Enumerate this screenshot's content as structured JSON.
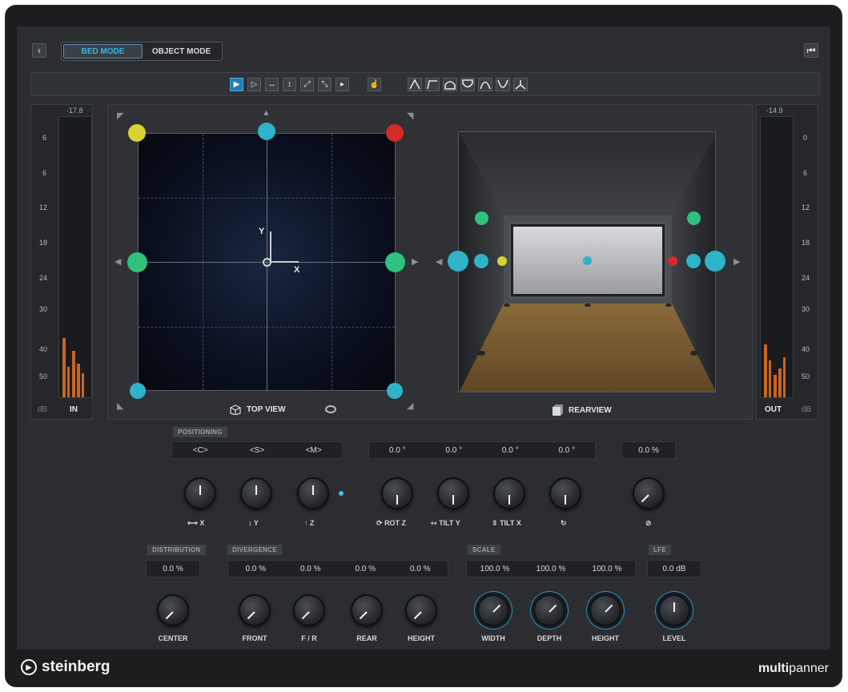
{
  "header": {
    "back_icon": "chevron-left-icon",
    "modes": [
      "BED MODE",
      "OBJECT MODE"
    ],
    "active_mode": "BED MODE",
    "end_icon": "skip-to-start-icon"
  },
  "toolbar": {
    "tools": [
      "select-arrow-icon",
      "select-outline-icon",
      "move-x-icon",
      "move-y-icon",
      "move-diagonal-icon",
      "move-diagonal-alt-icon",
      "cursor-flag-icon",
      "hand-pointer-icon"
    ],
    "shapes": [
      "shape-peak-icon",
      "shape-corner-icon",
      "shape-dome-icon",
      "shape-bowl-icon",
      "shape-arch-icon",
      "shape-valley-icon",
      "shape-fork-icon"
    ]
  },
  "meter_in": {
    "peak": "-17.8",
    "ticks": [
      "6",
      "6",
      "12",
      "18",
      "24",
      "30",
      "40",
      "50"
    ],
    "unit": "dB",
    "label": "IN"
  },
  "meter_out": {
    "peak": "-14.9",
    "ticks": [
      "0",
      "6",
      "12",
      "18",
      "24",
      "30",
      "40",
      "50"
    ],
    "unit": "dB",
    "label": "OUT"
  },
  "views": {
    "top_label": "TOP VIEW",
    "rear_label": "REARVIEW",
    "axis_y": "Y",
    "axis_x": "X"
  },
  "positioning": {
    "tag": "POSITIONING",
    "fields1": [
      "<C>",
      "<S>",
      "<M>"
    ],
    "fields2": [
      "0.0 °",
      "0.0 °",
      "0.0 °",
      "0.0 °"
    ],
    "field3": "0.0 %",
    "knob_labels": [
      "X",
      "Y",
      "Z",
      "ROT Z",
      "TILT Y",
      "TILT X"
    ]
  },
  "distribution": {
    "tag": "DISTRIBUTION",
    "value": "0.0 %",
    "knob": "CENTER"
  },
  "divergence": {
    "tag": "DIVERGENCE",
    "values": [
      "0.0 %",
      "0.0 %",
      "0.0 %",
      "0.0 %"
    ],
    "knobs": [
      "FRONT",
      "F / R",
      "REAR",
      "HEIGHT"
    ]
  },
  "scale": {
    "tag": "SCALE",
    "values": [
      "100.0 %",
      "100.0 %",
      "100.0 %"
    ],
    "knobs": [
      "WIDTH",
      "DEPTH",
      "HEIGHT"
    ]
  },
  "lfe": {
    "tag": "LFE",
    "value": "0.0 dB",
    "knob": "LEVEL"
  },
  "footer": {
    "brand": "steinberg",
    "product_bold": "multi",
    "product_rest": "panner"
  },
  "colors": {
    "accent": "#39b6e6",
    "speaker_teal": "#2fb3c8",
    "speaker_green": "#2ec27e",
    "speaker_yellow": "#d8d234",
    "speaker_red": "#d42a2a",
    "meter_orange": "#c9661f"
  }
}
